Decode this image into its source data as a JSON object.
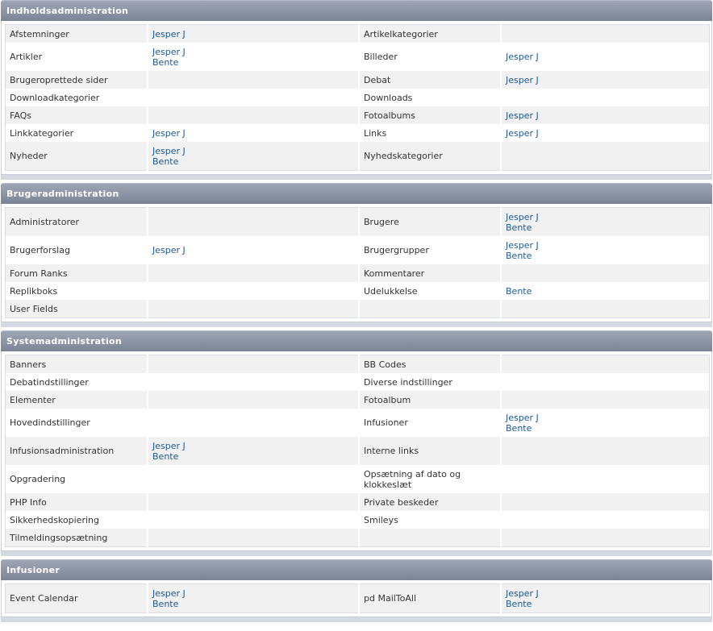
{
  "sections": [
    {
      "title": "Indholdsadministration",
      "rows": [
        {
          "h": 1,
          "a": "Afstemninger",
          "ap": [
            "Jesper J"
          ],
          "b": "Artikelkategorier",
          "bp": []
        },
        {
          "h": 2,
          "a": "Artikler",
          "ap": [
            "Jesper J",
            "Bente"
          ],
          "b": "Billeder",
          "bp": [
            "Jesper J"
          ]
        },
        {
          "h": 1,
          "a": "Brugeroprettede sider",
          "ap": [],
          "b": "Debat",
          "bp": [
            "Jesper J"
          ]
        },
        {
          "h": 1,
          "a": "Downloadkategorier",
          "ap": [],
          "b": "Downloads",
          "bp": []
        },
        {
          "h": 1,
          "a": "FAQs",
          "ap": [],
          "b": "Fotoalbums",
          "bp": [
            "Jesper J"
          ]
        },
        {
          "h": 1,
          "a": "Linkkategorier",
          "ap": [
            "Jesper J"
          ],
          "b": "Links",
          "bp": [
            "Jesper J"
          ]
        },
        {
          "h": 2,
          "a": "Nyheder",
          "ap": [
            "Jesper J",
            "Bente"
          ],
          "b": "Nyhedskategorier",
          "bp": []
        }
      ]
    },
    {
      "title": "Brugeradministration",
      "rows": [
        {
          "h": 2,
          "a": "Administratorer",
          "ap": [],
          "b": "Brugere",
          "bp": [
            "Jesper J",
            "Bente"
          ]
        },
        {
          "h": 2,
          "a": "Brugerforslag",
          "ap": [
            "Jesper J"
          ],
          "b": "Brugergrupper",
          "bp": [
            "Jesper J",
            "Bente"
          ]
        },
        {
          "h": 1,
          "a": "Forum Ranks",
          "ap": [],
          "b": "Kommentarer",
          "bp": []
        },
        {
          "h": 1,
          "a": "Replikboks",
          "ap": [],
          "b": "Udelukkelse",
          "bp": [
            "Bente"
          ]
        },
        {
          "h": 1,
          "a": "User Fields",
          "ap": [],
          "b": "",
          "bp": []
        }
      ]
    },
    {
      "title": "Systemadministration",
      "rows": [
        {
          "h": 1,
          "a": "Banners",
          "ap": [],
          "b": "BB Codes",
          "bp": []
        },
        {
          "h": 1,
          "a": "Debatindstillinger",
          "ap": [],
          "b": "Diverse indstillinger",
          "bp": []
        },
        {
          "h": 1,
          "a": "Elementer",
          "ap": [],
          "b": "Fotoalbum",
          "bp": []
        },
        {
          "h": 2,
          "a": "Hovedindstillinger",
          "ap": [],
          "b": "Infusioner",
          "bp": [
            "Jesper J",
            "Bente"
          ]
        },
        {
          "h": 2,
          "a": "Infusionsadministration",
          "ap": [
            "Jesper J",
            "Bente"
          ],
          "b": "Interne links",
          "bp": []
        },
        {
          "h": 2,
          "a": "Opgradering",
          "ap": [],
          "b": "Opsætning af dato og klokkeslæt",
          "bp": []
        },
        {
          "h": 1,
          "a": "PHP Info",
          "ap": [],
          "b": "Private beskeder",
          "bp": []
        },
        {
          "h": 1,
          "a": "Sikkerhedskopiering",
          "ap": [],
          "b": "Smileys",
          "bp": []
        },
        {
          "h": 1,
          "a": "Tilmeldingsopsætning",
          "ap": [],
          "b": "",
          "bp": []
        }
      ]
    },
    {
      "title": "Infusioner",
      "rows": [
        {
          "h": 2,
          "a": "Event Calendar",
          "ap": [
            "Jesper J",
            "Bente"
          ],
          "b": "pd MailToAll",
          "bp": [
            "Jesper J",
            "Bente"
          ]
        }
      ]
    }
  ]
}
